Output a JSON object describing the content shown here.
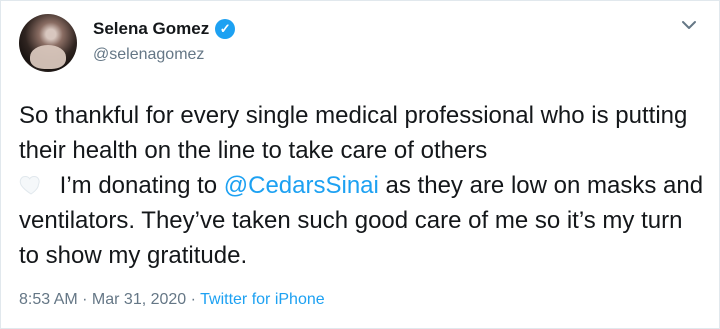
{
  "tweet": {
    "author_name": "Selena Gomez",
    "author_handle": "@selenagomez",
    "verified_icon": "verified-badge-icon",
    "text_part1": "So thankful for every single medical professional who is putting their health on the line to take care of others",
    "text_part2": " I’m donating to ",
    "mention": "@CedarsSinai",
    "text_part3": " as they are low on masks and ventilators. They’ve taken such good care of me so it’s my turn to show my gratitude.",
    "timestamp": "8:53 AM · Mar 31, 2020 · ",
    "source": "Twitter for iPhone"
  },
  "colors": {
    "accent": "#1da1f2",
    "secondary_text": "#657786",
    "primary_text": "#14171a",
    "border": "#e1e8ed"
  },
  "icons": {
    "verified": "check-icon",
    "more": "chevron-down-icon",
    "heart": "white-heart-icon"
  }
}
